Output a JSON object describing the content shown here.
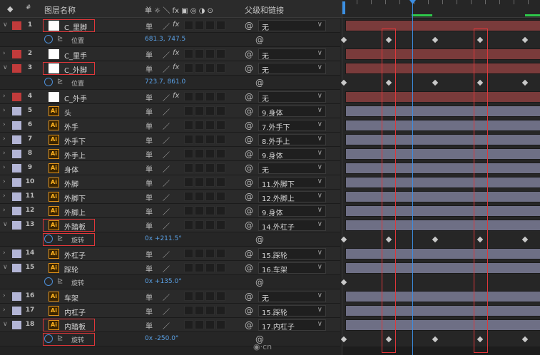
{
  "header": {
    "tag_icon": "label-tag-icon",
    "number_col": "#",
    "layer_name_col": "图层名称",
    "switch_icons": "单 ☼ ＼ fx ▣ ◎ ◑ ⊙",
    "parent_col": "父级和链接"
  },
  "colors": {
    "label_red": "#c13b3b",
    "label_lavender": "#b3b5d6",
    "playhead_blue": "#3c8ee3",
    "work_area_green": "#2ec84a",
    "bar_red": "#7a3b3b",
    "bar_lavender": "#6e6f85",
    "highlight_red": "#e0373a"
  },
  "rows": [
    {
      "type": "layer",
      "expanded": true,
      "label": "red",
      "num": "1",
      "thumb": "white",
      "name": "C_里脚",
      "fx": true,
      "parent": "无",
      "keyframes": [],
      "box": true
    },
    {
      "type": "prop",
      "name": "位置",
      "value": "681.3, 747.5",
      "keyframes": [
        2,
        65,
        130,
        193,
        256
      ]
    },
    {
      "type": "layer",
      "expanded": false,
      "label": "red",
      "num": "2",
      "thumb": "white",
      "name": "C_里手",
      "fx": true,
      "parent": "无"
    },
    {
      "type": "layer",
      "expanded": true,
      "label": "red",
      "num": "3",
      "thumb": "white",
      "name": "C_外脚",
      "fx": true,
      "parent": "无",
      "box": true
    },
    {
      "type": "prop",
      "name": "位置",
      "value": "723.7, 861.0",
      "keyframes": [
        2,
        65,
        130,
        193,
        256
      ]
    },
    {
      "type": "layer",
      "expanded": false,
      "label": "red",
      "num": "4",
      "thumb": "white",
      "name": "C_外手",
      "fx": true,
      "parent": "无"
    },
    {
      "type": "layer",
      "expanded": false,
      "label": "lavender",
      "num": "5",
      "thumb": "ai",
      "name": "头",
      "fx": false,
      "parent": "9.身体"
    },
    {
      "type": "layer",
      "expanded": false,
      "label": "lavender",
      "num": "6",
      "thumb": "ai",
      "name": "外手",
      "fx": false,
      "parent": "7.外手下"
    },
    {
      "type": "layer",
      "expanded": false,
      "label": "lavender",
      "num": "7",
      "thumb": "ai",
      "name": "外手下",
      "fx": false,
      "parent": "8.外手上"
    },
    {
      "type": "layer",
      "expanded": false,
      "label": "lavender",
      "num": "8",
      "thumb": "ai",
      "name": "外手上",
      "fx": false,
      "parent": "9.身体"
    },
    {
      "type": "layer",
      "expanded": false,
      "label": "lavender",
      "num": "9",
      "thumb": "ai",
      "name": "身体",
      "fx": false,
      "parent": "无"
    },
    {
      "type": "layer",
      "expanded": false,
      "label": "lavender",
      "num": "10",
      "thumb": "ai",
      "name": "外脚",
      "fx": false,
      "parent": "11.外脚下"
    },
    {
      "type": "layer",
      "expanded": false,
      "label": "lavender",
      "num": "11",
      "thumb": "ai",
      "name": "外脚下",
      "fx": false,
      "parent": "12.外脚上"
    },
    {
      "type": "layer",
      "expanded": false,
      "label": "lavender",
      "num": "12",
      "thumb": "ai",
      "name": "外脚上",
      "fx": false,
      "parent": "9.身体"
    },
    {
      "type": "layer",
      "expanded": true,
      "label": "lavender",
      "num": "13",
      "thumb": "ai",
      "name": "外踏板",
      "fx": false,
      "parent": "14.外杠子",
      "box": true
    },
    {
      "type": "prop",
      "name": "旋转",
      "value": "0x +211.5°",
      "keyframes": [
        2,
        65,
        130,
        193,
        256
      ]
    },
    {
      "type": "layer",
      "expanded": false,
      "label": "lavender",
      "num": "14",
      "thumb": "ai",
      "name": "外杠子",
      "fx": false,
      "parent": "15.踩轮"
    },
    {
      "type": "layer",
      "expanded": true,
      "label": "lavender",
      "num": "15",
      "thumb": "ai",
      "name": "踩轮",
      "fx": false,
      "parent": "16.车架"
    },
    {
      "type": "prop",
      "name": "旋转",
      "value": "0x +135.0°",
      "keyframes": [
        2
      ]
    },
    {
      "type": "layer",
      "expanded": false,
      "label": "lavender",
      "num": "16",
      "thumb": "ai",
      "name": "车架",
      "fx": false,
      "parent": "无"
    },
    {
      "type": "layer",
      "expanded": false,
      "label": "lavender",
      "num": "17",
      "thumb": "ai",
      "name": "内杠子",
      "fx": false,
      "parent": "15.踩轮"
    },
    {
      "type": "layer",
      "expanded": true,
      "label": "lavender",
      "num": "18",
      "thumb": "ai",
      "name": "内踏板",
      "fx": false,
      "parent": "17.内杠子",
      "box": true
    },
    {
      "type": "prop",
      "name": "旋转",
      "value": "0x -250.0°",
      "keyframes": [
        2,
        65,
        130,
        193,
        256
      ]
    }
  ],
  "timeline": {
    "work_area_segments": [
      [
        97,
        126
      ],
      [
        256,
        278
      ]
    ]
  },
  "watermark": "·cn"
}
